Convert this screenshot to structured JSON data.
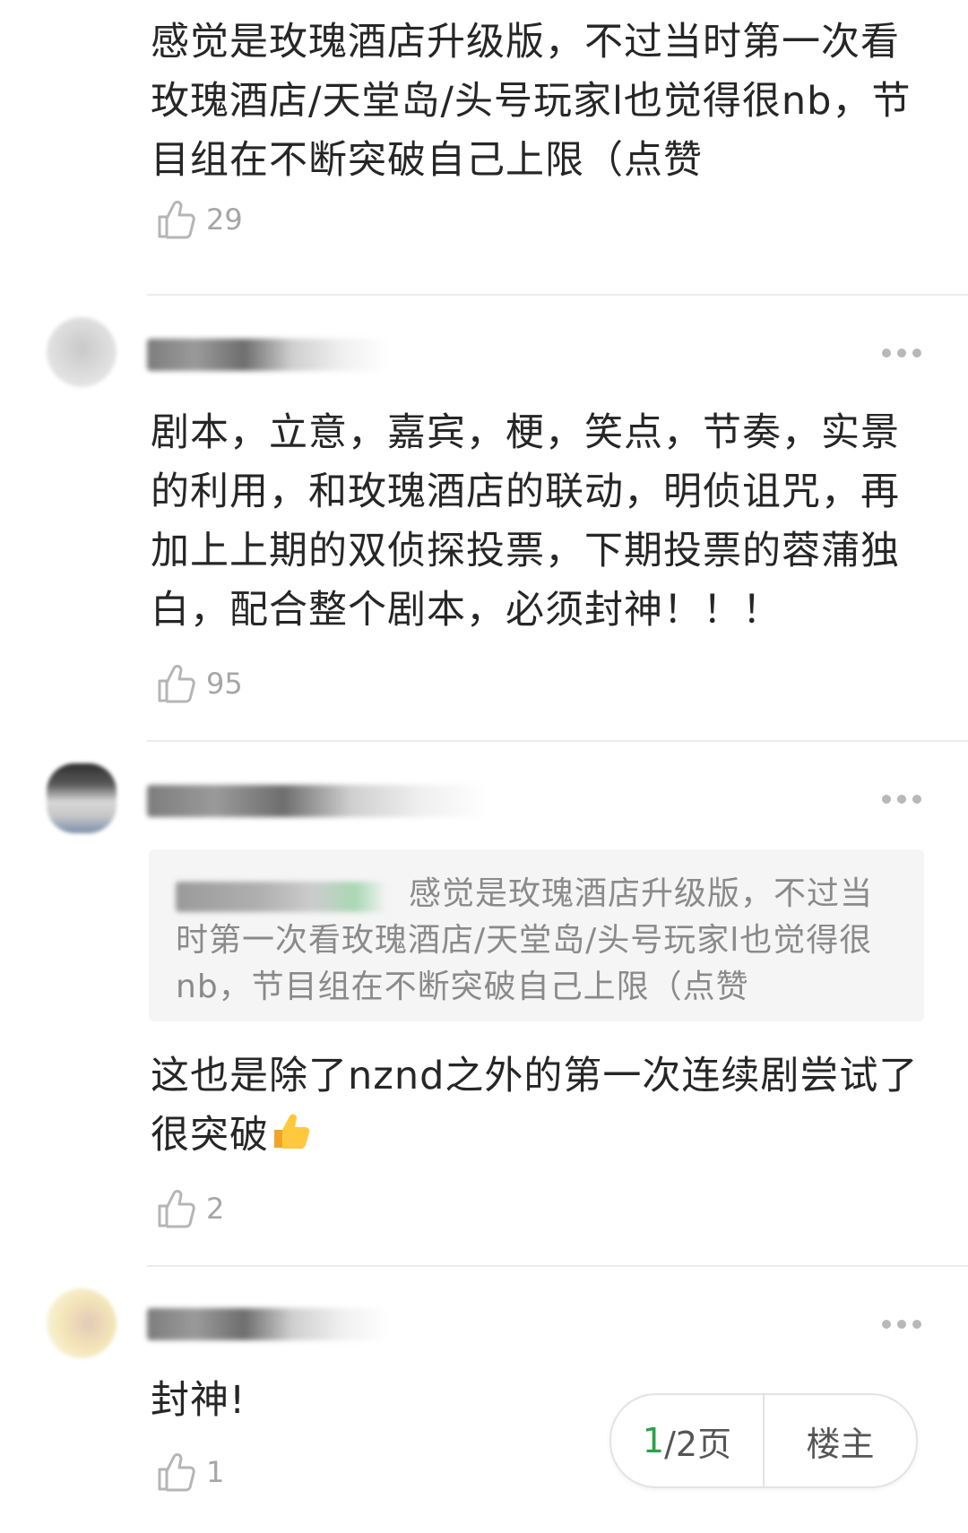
{
  "comments": [
    {
      "text": "感觉是玫瑰酒店升级版，不过当时第一次看玫瑰酒店/天堂岛/头号玩家l也觉得很nb，节目组在不断突破自己上限（点赞",
      "likes": "29"
    },
    {
      "text": "剧本，立意，嘉宾，梗，笑点，节奏，实景的利用，和玫瑰酒店的联动，明侦诅咒，再加上上期的双侦探投票，下期投票的蓉蒲独白，配合整个剧本，必须封神！！！",
      "likes": "95"
    },
    {
      "quote": "感觉是玫瑰酒店升级版，不过当时第一次看玫瑰酒店/天堂岛/头号玩家l也觉得很nb，节目组在不断突破自己上限（点赞",
      "text": "这也是除了nznd之外的第一次连续剧尝试了很突破",
      "likes": "2"
    },
    {
      "text": "封神!",
      "likes": "1"
    }
  ],
  "pager": {
    "current": "1",
    "total_label": "/2页",
    "op_label": "楼主"
  },
  "colors": {
    "accent": "#2ba245",
    "divider": "#ececec",
    "muted": "#a6a6a6"
  },
  "icons": [
    "thumbs-up-icon",
    "more-icon",
    "thumbs-up-emoji"
  ]
}
